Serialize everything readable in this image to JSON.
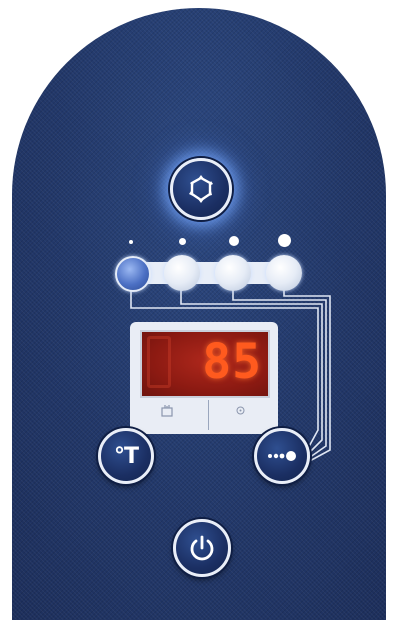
{
  "display": {
    "value": "85"
  },
  "buttons": {
    "mode": {
      "icon": "cycle-arrows-icon"
    },
    "temperature": {
      "label": "°T",
      "icon": "temperature-icon"
    },
    "more": {
      "icon": "dots-arrow-icon"
    },
    "power": {
      "icon": "power-icon"
    }
  },
  "indicators": {
    "level_count": 4,
    "active_level": 1
  },
  "colors": {
    "panel": "#243a66",
    "display_background": "#8f1c14",
    "display_digits": "#ff5a1e",
    "button_ring": "#e9eef8",
    "mode_glow": "#78aaff"
  }
}
